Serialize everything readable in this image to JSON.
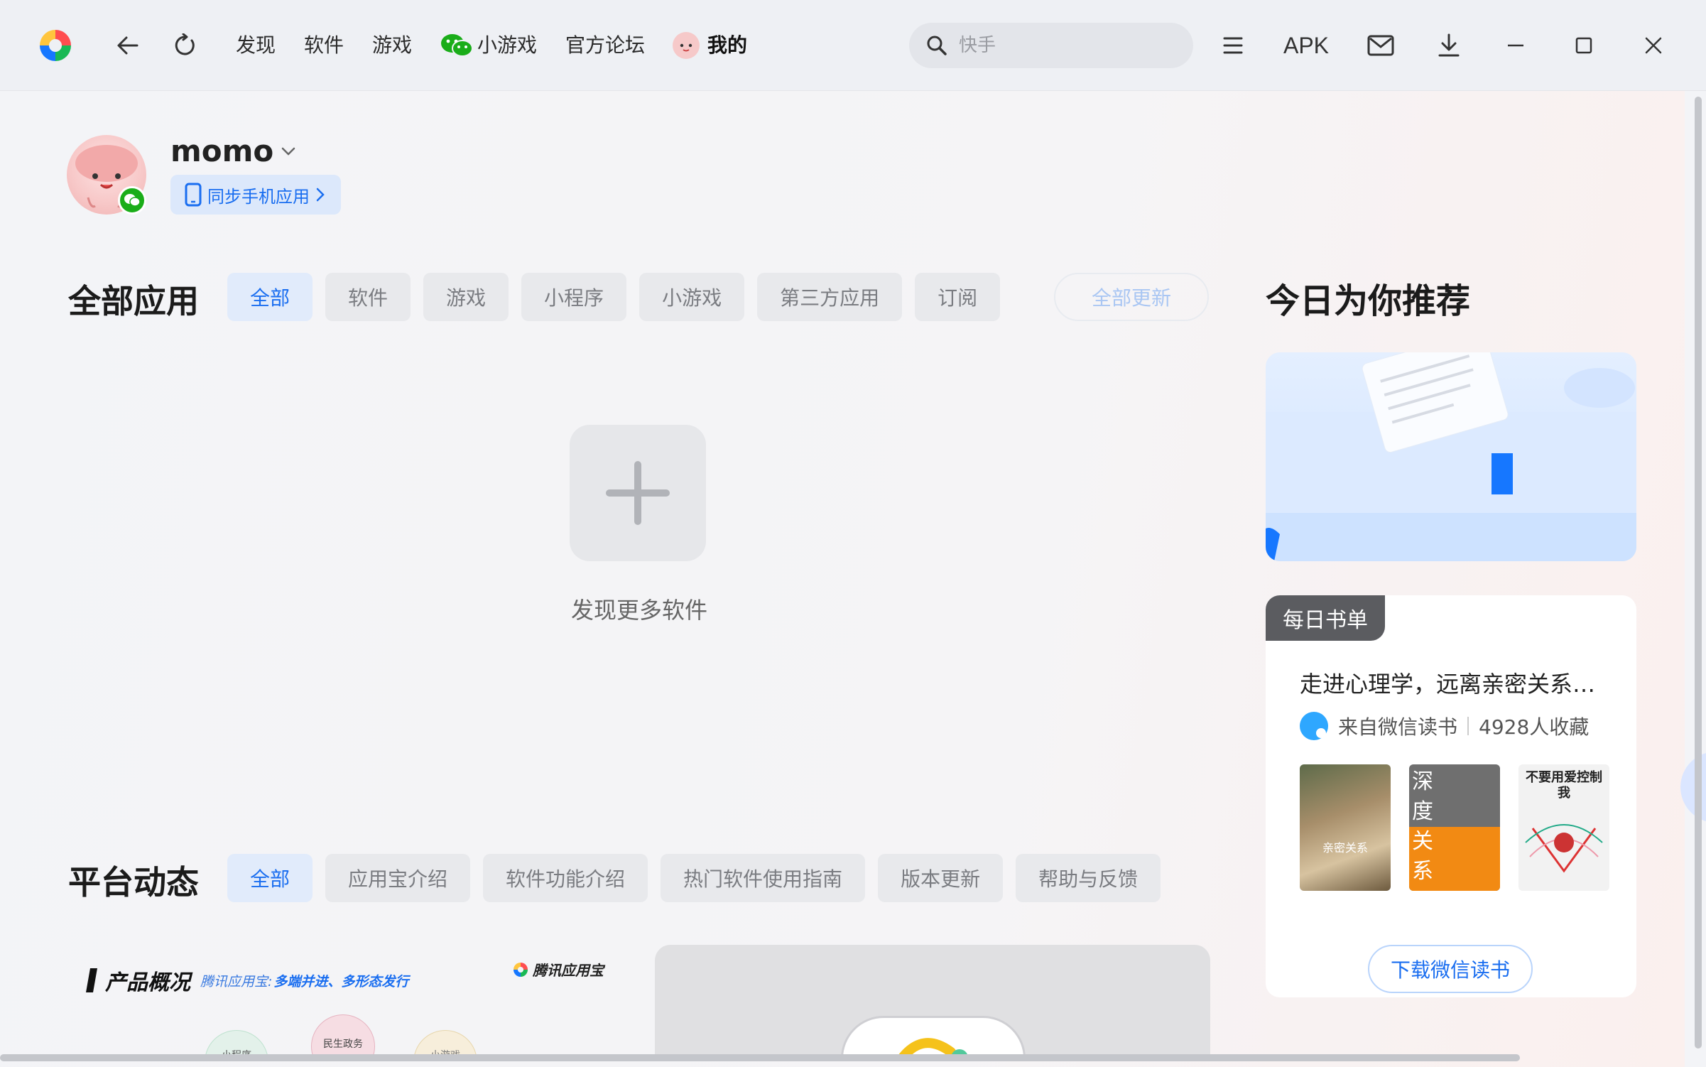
{
  "titlebar": {
    "nav": [
      "发现",
      "软件",
      "游戏",
      "小游戏",
      "官方论坛",
      "我的"
    ],
    "search_placeholder": "快手",
    "apk_label": "APK",
    "icons": [
      "app-logo-icon",
      "back-icon",
      "refresh-icon",
      "wechat-icon",
      "user-avatar-icon",
      "search-icon",
      "menu-icon",
      "mail-icon",
      "download-icon",
      "minimize-icon",
      "maximize-icon",
      "close-icon"
    ]
  },
  "profile": {
    "username": "momo",
    "sync_label": "同步手机应用"
  },
  "apps": {
    "title": "全部应用",
    "tabs": [
      "全部",
      "软件",
      "游戏",
      "小程序",
      "小游戏",
      "第三方应用",
      "订阅"
    ],
    "active_tab": "全部",
    "update_all": "全部更新",
    "empty_text": "发现更多软件"
  },
  "platform": {
    "title": "平台动态",
    "tabs": [
      "全部",
      "应用宝介绍",
      "软件功能介绍",
      "热门软件使用指南",
      "版本更新",
      "帮助与反馈"
    ],
    "active_tab": "全部",
    "preview": {
      "heading": "产品概况",
      "sub_prefix": "腾讯应用宝:",
      "sub_highlight": "多端并进、多形态发行",
      "brand": "腾讯应用宝",
      "bubbles": [
        "小程序",
        "民生政务",
        "小游戏"
      ]
    }
  },
  "recommend": {
    "title": "今日为你推荐",
    "card": {
      "badge": "每日书单",
      "headline": "走进心理学，远离亲密关系…",
      "source": "来自微信读书",
      "favorites": "4928人收藏",
      "books": [
        {
          "title": "亲密关系"
        },
        {
          "title": "深度关系"
        },
        {
          "title": "不要用爱控制我"
        }
      ],
      "download_label": "下载微信读书"
    }
  },
  "colors": {
    "accent": "#1a6ef0",
    "wechat_green": "#1aad19",
    "badge_gray": "#5b5c60"
  }
}
